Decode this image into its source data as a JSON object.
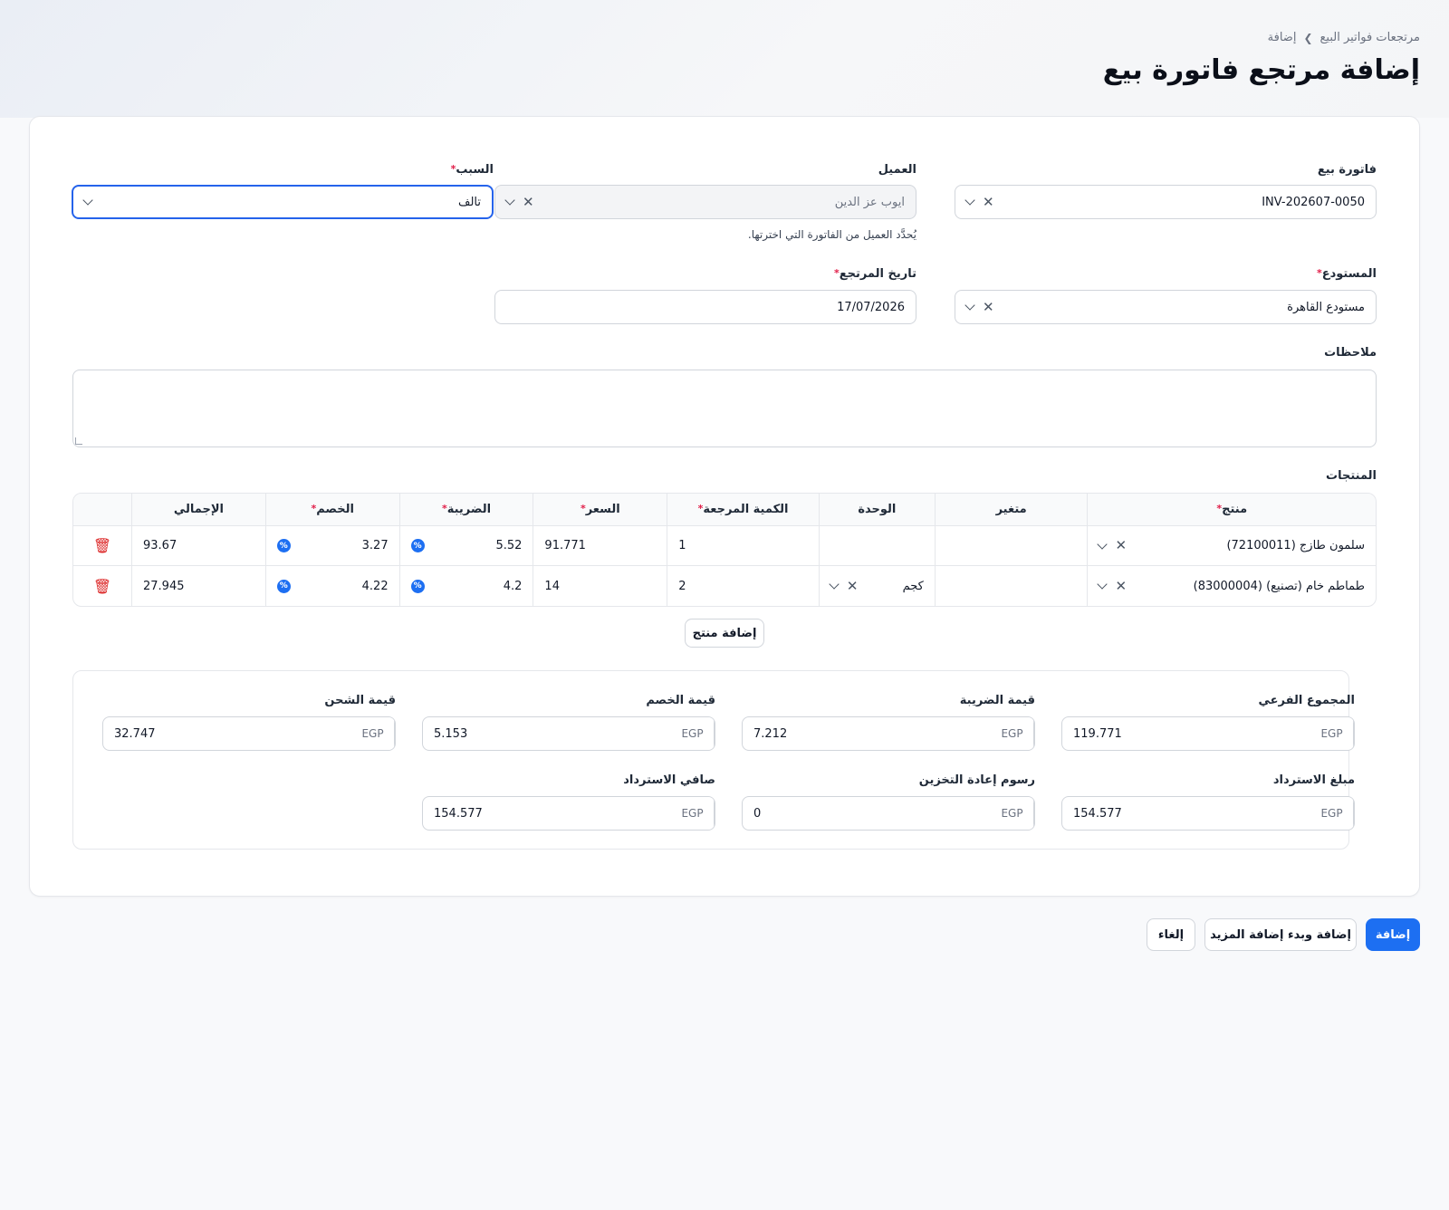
{
  "breadcrumb": {
    "parent": "مرتجعات فواتير البيع",
    "current": "إضافة"
  },
  "page_title": "إضافة مرتجع فاتورة بيع",
  "form": {
    "invoice": {
      "label": "فاتورة بيع",
      "value": "INV-202607-0050"
    },
    "customer": {
      "label": "العميل",
      "value": "ايوب عز الدين",
      "hint": "يُحدَّد العميل من الفاتورة التي اخترتها."
    },
    "reason": {
      "label": "السبب",
      "required_mark": "*",
      "value": "تالف"
    },
    "warehouse": {
      "label": "المستودع",
      "required_mark": "*",
      "value": "مستودع القاهرة"
    },
    "return_date": {
      "label": "تاريخ المرتجع",
      "required_mark": "*",
      "value": "17/07/2026"
    },
    "notes": {
      "label": "ملاحظات",
      "value": ""
    }
  },
  "products": {
    "label": "المنتجات",
    "columns": {
      "product": "منتج",
      "variant": "متغير",
      "unit": "الوحدة",
      "return_qty": "الكمية المرجعة",
      "price": "السعر",
      "tax": "الضريبة",
      "discount": "الخصم",
      "total": "الإجمالي"
    },
    "rows": [
      {
        "product": "سلمون طازج (72100011)",
        "variant": "",
        "unit": "",
        "qty": "1",
        "price": "91.771",
        "tax": "5.52",
        "discount": "3.27",
        "total": "93.67"
      },
      {
        "product": "طماطم خام (تصنيع) (83000004)",
        "variant": "",
        "unit": "كجم",
        "qty": "2",
        "price": "14",
        "tax": "4.2",
        "discount": "4.22",
        "total": "27.945"
      }
    ],
    "add_button": "إضافة منتج"
  },
  "summary": {
    "currency": "EGP",
    "subtotal": {
      "label": "المجموع الفرعي",
      "value": "119.771"
    },
    "tax_value": {
      "label": "قيمة الضريبة",
      "value": "7.212"
    },
    "discount_value": {
      "label": "قيمة الخصم",
      "value": "5.153"
    },
    "shipping_value": {
      "label": "قيمة الشحن",
      "value": "32.747"
    },
    "refund_amount": {
      "label": "مبلغ الاسترداد",
      "value": "154.577"
    },
    "restocking_fee": {
      "label": "رسوم إعادة التخزين",
      "value": "0"
    },
    "net_refund": {
      "label": "صافي الاسترداد",
      "value": "154.577"
    }
  },
  "actions": {
    "add": "إضافة",
    "add_and_more": "إضافة وبدء إضافة المزيد",
    "cancel": "إلغاء"
  },
  "colors": {
    "primary": "#1d6ff2",
    "danger": "#dc2626",
    "required": "#e11d48"
  }
}
